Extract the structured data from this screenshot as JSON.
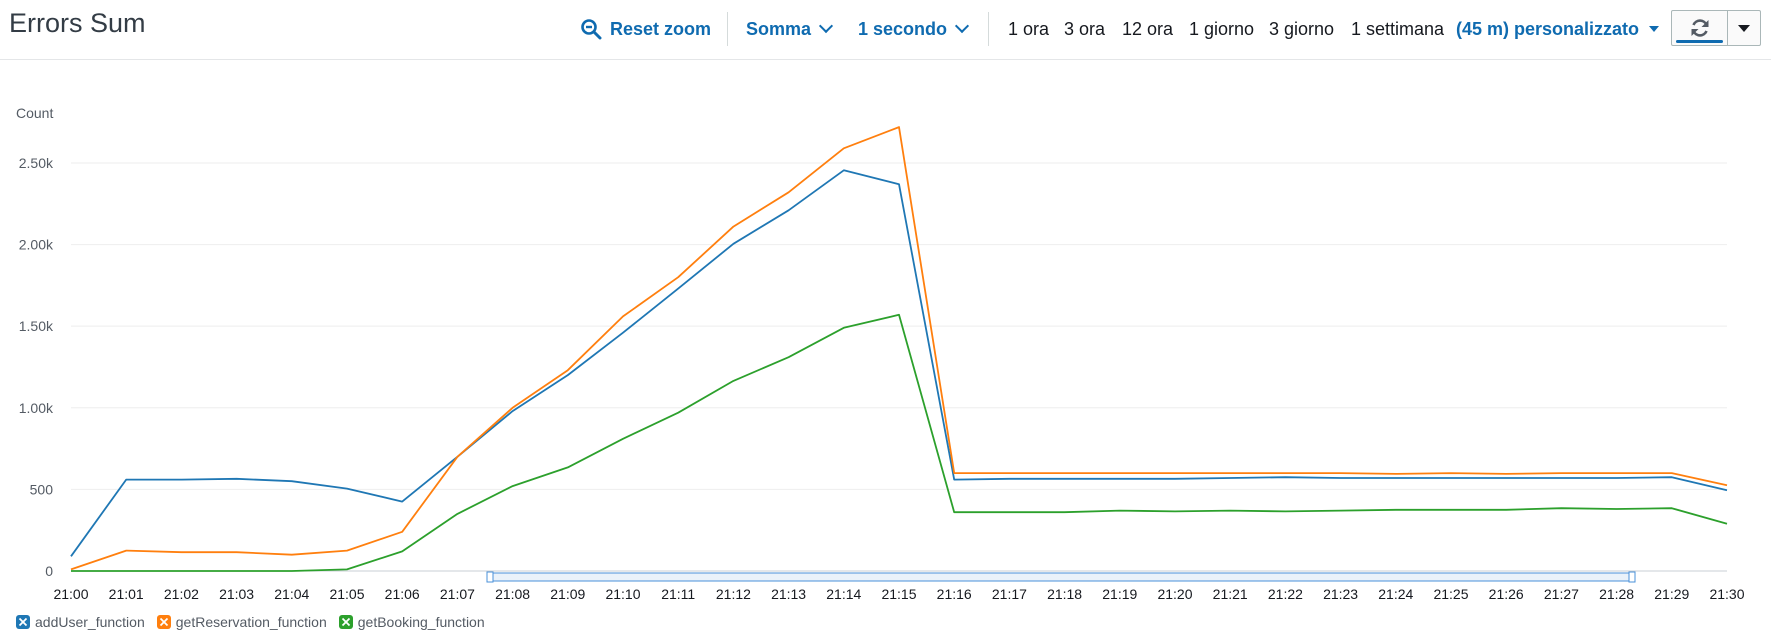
{
  "header": {
    "title": "Errors Sum",
    "reset_zoom": "Reset zoom",
    "statistic": "Somma",
    "period": "1 secondo",
    "ranges": [
      "1 ora",
      "3 ora",
      "12 ora",
      "1 giorno",
      "3 giorno",
      "1 settimana"
    ],
    "custom_range": "(45 m) personalizzato"
  },
  "colors": {
    "accent": "#0f6bb0",
    "series": [
      "#1f77b4",
      "#ff7f0e",
      "#2ca02c"
    ]
  },
  "chart_data": {
    "type": "line",
    "ylabel": "Count",
    "ylim": [
      0,
      2800
    ],
    "yticks": [
      0,
      500,
      1000,
      1500,
      2000,
      2500
    ],
    "ytick_labels": [
      "0",
      "500",
      "1.00k",
      "1.50k",
      "2.00k",
      "2.50k"
    ],
    "x": [
      "21:00",
      "21:01",
      "21:02",
      "21:03",
      "21:04",
      "21:05",
      "21:06",
      "21:07",
      "21:08",
      "21:09",
      "21:10",
      "21:11",
      "21:12",
      "21:13",
      "21:14",
      "21:15",
      "21:16",
      "21:17",
      "21:18",
      "21:19",
      "21:20",
      "21:21",
      "21:22",
      "21:23",
      "21:24",
      "21:25",
      "21:26",
      "21:27",
      "21:28",
      "21:29",
      "21:30"
    ],
    "grid": true,
    "legend_position": "bottom-left",
    "series": [
      {
        "name": "addUser_function",
        "values": [
          90,
          560,
          560,
          565,
          550,
          505,
          425,
          700,
          980,
          1200,
          1460,
          1730,
          2005,
          2210,
          2455,
          2370,
          560,
          565,
          565,
          565,
          565,
          570,
          575,
          570,
          570,
          570,
          570,
          570,
          570,
          575,
          495
        ]
      },
      {
        "name": "getReservation_function",
        "values": [
          10,
          125,
          115,
          115,
          100,
          125,
          240,
          700,
          1000,
          1230,
          1560,
          1800,
          2110,
          2320,
          2590,
          2720,
          600,
          600,
          600,
          600,
          600,
          600,
          600,
          600,
          595,
          600,
          595,
          600,
          600,
          600,
          525
        ]
      },
      {
        "name": "getBooking_function",
        "values": [
          0,
          0,
          0,
          0,
          0,
          10,
          120,
          350,
          520,
          635,
          810,
          970,
          1165,
          1310,
          1490,
          1570,
          360,
          360,
          360,
          370,
          365,
          370,
          365,
          370,
          375,
          375,
          375,
          385,
          380,
          385,
          290
        ]
      }
    ]
  }
}
